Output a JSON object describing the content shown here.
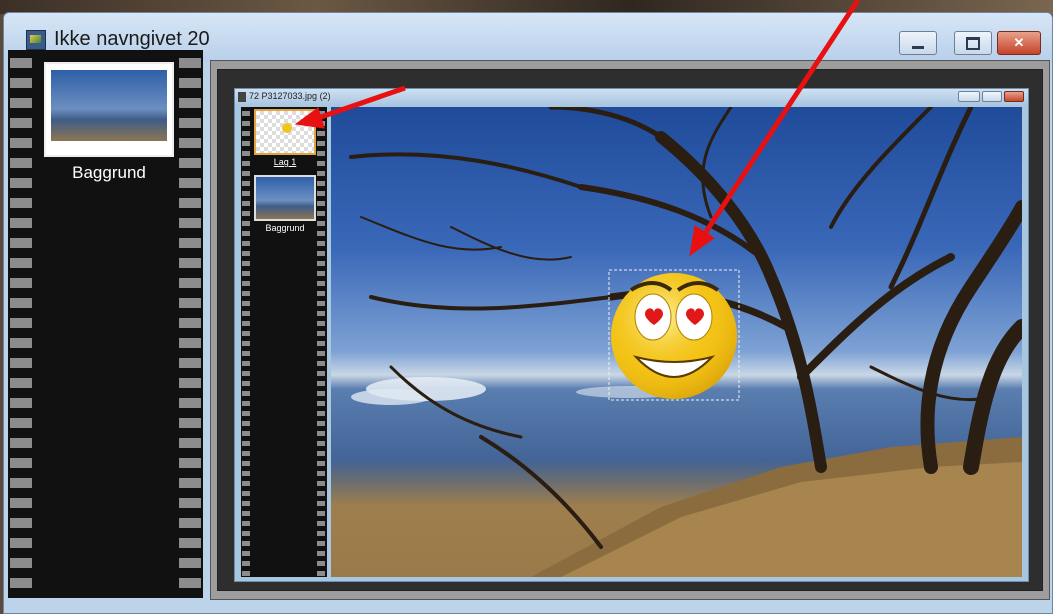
{
  "window": {
    "title": "Ikke navngivet 20",
    "minimize": "–",
    "maximize": "□",
    "close": "✕"
  },
  "layers_panel": {
    "items": [
      {
        "label": "Baggrund"
      }
    ]
  },
  "image_window": {
    "title": "72 P3127033.jpg (2)",
    "layers": [
      {
        "label": "Lag 1"
      },
      {
        "label": "Baggrund"
      }
    ]
  },
  "colors": {
    "arrow": "#e81010",
    "selection_border": "#e3a340",
    "smiley": "#f2c418"
  }
}
